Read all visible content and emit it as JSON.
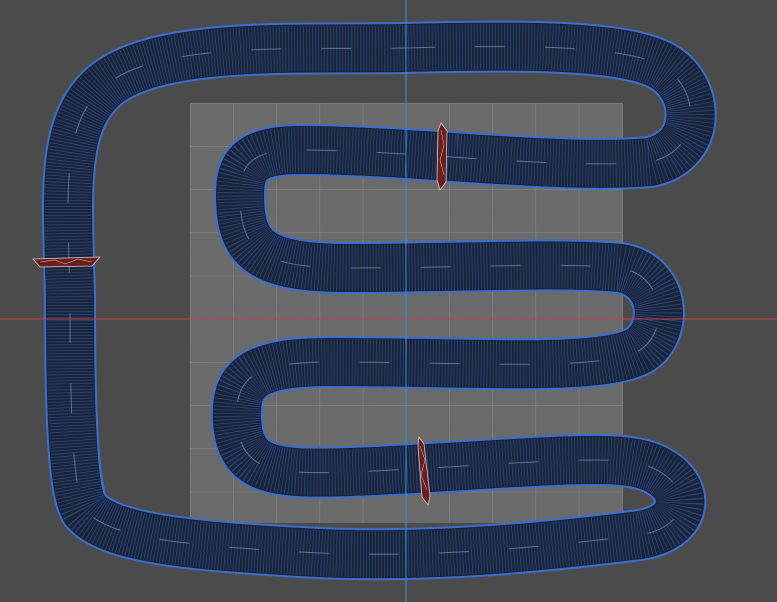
{
  "viewport": {
    "name": "3d-viewport-top",
    "background": "#4b4b4b",
    "grid_color": "#8a8a8a",
    "grid_minor_color": "#6e6e6e",
    "axis_x_color": "#c0404a",
    "axis_y_color": "#3f8fd8"
  },
  "track": {
    "name": "race-track-mesh",
    "fill_color": "#1a2438",
    "wire_color": "#2f5fb8",
    "edge_color": "#3a6fd0",
    "centerline_color": "#7f90b0"
  },
  "checkpoints": {
    "fill_color": "#6a1e1e",
    "edge_color": "#d8c8c8",
    "items": [
      {
        "name": "checkpoint-left"
      },
      {
        "name": "checkpoint-top"
      },
      {
        "name": "checkpoint-bottom"
      }
    ]
  }
}
